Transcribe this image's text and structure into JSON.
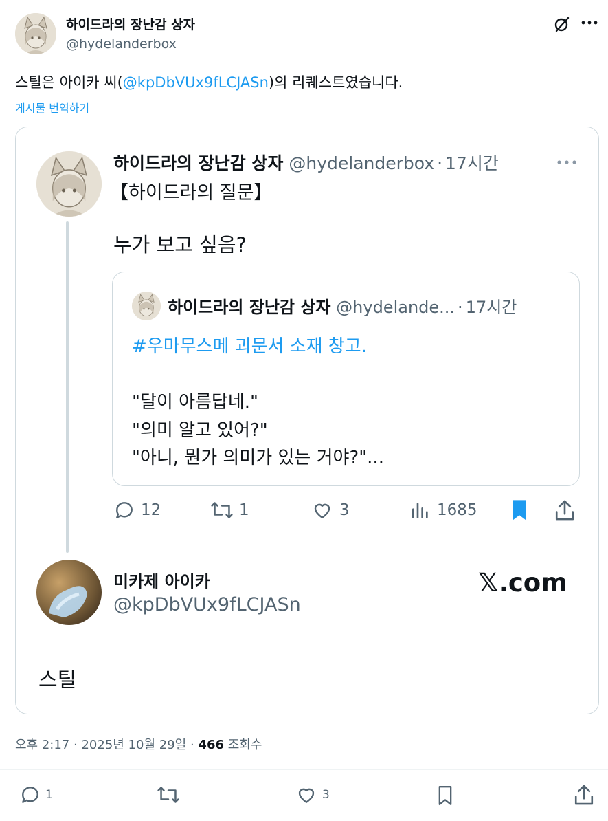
{
  "author": {
    "display_name": "하이드라의 장난감 상자",
    "handle": "@hydelanderbox"
  },
  "tweet": {
    "text_before": "스틸은 아이카 씨(",
    "mention": "@kpDbVUx9fLCJASn",
    "text_after": ")의 리퀘스트였습니다.",
    "translate_label": "게시물 번역하기"
  },
  "quoted": {
    "display_name": "하이드라의 장난감 상자",
    "handle": "@hydelanderbox",
    "sep": "·",
    "time": "17시간",
    "line1": "【하이드라의 질문】",
    "line2": "누가 보고 싶음?",
    "nested": {
      "display_name": "하이드라의 장난감 상자",
      "handle": "@hydelande...",
      "sep": "·",
      "time": "17시간",
      "hashtag": "#우마무스메 괴문서 소재 창고.",
      "quote1": "\"달이 아름답네.\"",
      "quote2": "\"의미 알고 있어?\"",
      "quote3": "\"아니, 뭔가 의미가 있는 거야?\"..."
    },
    "actions": {
      "replies": "12",
      "retweets": "1",
      "likes": "3",
      "views": "1685"
    },
    "reply_card": {
      "display_name": "미카제 아이카",
      "handle": "@kpDbVUx9fLCJASn",
      "site_label": "𝕏.com",
      "text": "스틸"
    }
  },
  "meta": {
    "time": "오후 2:17",
    "sep1": "·",
    "date": "2025년 10월 29일",
    "sep2": "·",
    "views_count": "466",
    "views_label": "조회수"
  },
  "bottom_actions": {
    "replies": "1",
    "likes": "3"
  },
  "colors": {
    "link": "#1d9bf0",
    "muted": "#536471",
    "bookmark_active": "#1d9bf0",
    "border": "#cfd9de"
  }
}
